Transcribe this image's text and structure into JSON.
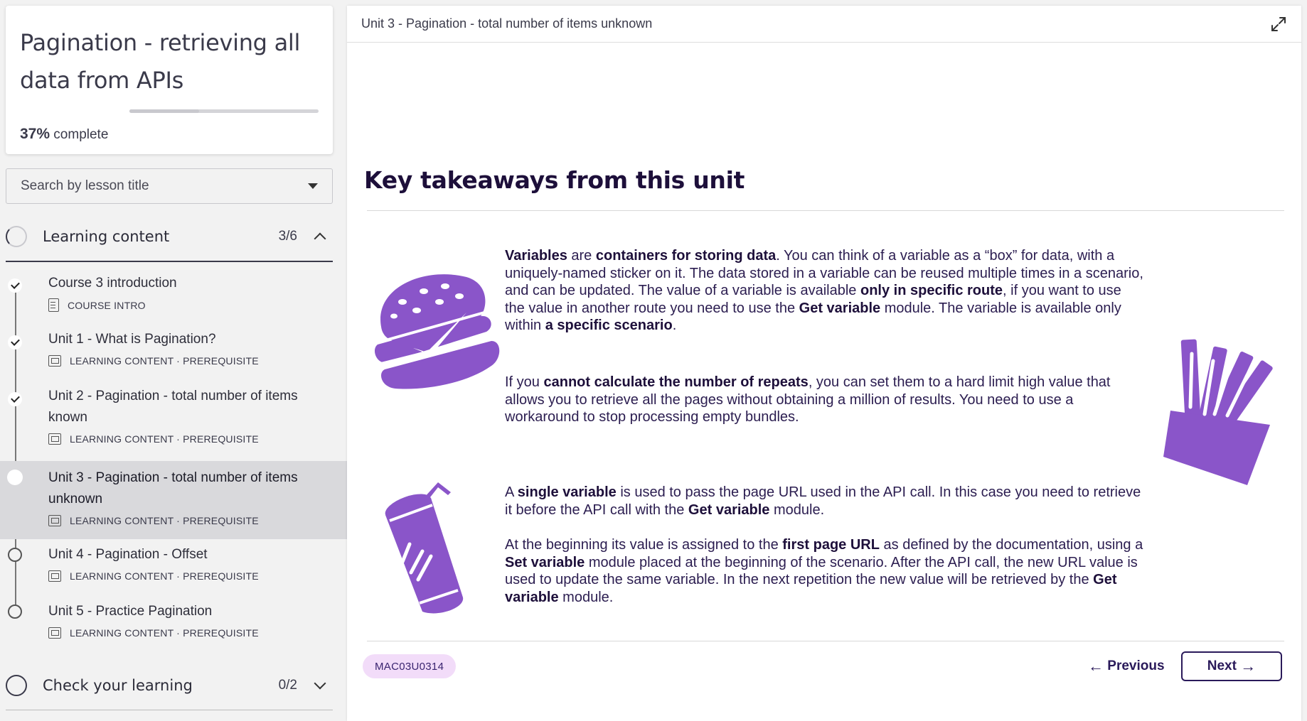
{
  "course": {
    "title": "Pagination - retrieving all data from APIs",
    "progress_percent": "37%",
    "progress_suffix": " complete",
    "progress_fraction": 0.37
  },
  "search": {
    "placeholder": "Search by lesson title"
  },
  "sections": [
    {
      "title": "Learning content",
      "count": "3/6",
      "expanded": true,
      "lessons": [
        {
          "title": "Course 3 introduction",
          "meta": "COURSE INTRO",
          "status": "done",
          "icon": "document-icon"
        },
        {
          "title": "Unit 1 - What is Pagination?",
          "meta": "LEARNING CONTENT · PREREQUISITE",
          "status": "done",
          "icon": "slides-icon"
        },
        {
          "title": "Unit 2 - Pagination - total number of items known",
          "meta": "LEARNING CONTENT · PREREQUISITE",
          "status": "done",
          "icon": "slides-icon"
        },
        {
          "title": "Unit 3 - Pagination - total number of items unknown",
          "meta": "LEARNING CONTENT · PREREQUISITE",
          "status": "current",
          "icon": "slides-icon"
        },
        {
          "title": "Unit 4 - Pagination - Offset",
          "meta": "LEARNING CONTENT · PREREQUISITE",
          "status": "open",
          "icon": "slides-icon"
        },
        {
          "title": "Unit 5 - Practice Pagination",
          "meta": "LEARNING CONTENT · PREREQUISITE",
          "status": "open",
          "icon": "slides-icon"
        }
      ]
    },
    {
      "title": "Check your learning",
      "count": "0/2",
      "expanded": false
    }
  ],
  "main": {
    "header_title": "Unit 3 - Pagination - total number of items unknown",
    "heading": "Key takeaways from this unit",
    "accent_color": "#8a55c9",
    "paragraphs": [
      [
        {
          "b": true,
          "t": "Variables"
        },
        {
          "t": " are "
        },
        {
          "b": true,
          "t": "containers for storing data"
        },
        {
          "t": ". You can think of a variable as a “box” for data, with a uniquely-named sticker on it. The data stored in a variable can be reused multiple times in a scenario, and can be updated. The value of a variable is available "
        },
        {
          "b": true,
          "t": "only in specific route"
        },
        {
          "t": ", if you want to use the value in another route you need to use the "
        },
        {
          "b": true,
          "t": "Get variable"
        },
        {
          "t": " module. The variable is available only within "
        },
        {
          "b": true,
          "t": "a specific scenario"
        },
        {
          "t": "."
        }
      ],
      [
        {
          "t": "If you "
        },
        {
          "b": true,
          "t": "cannot calculate the number of repeats"
        },
        {
          "t": ", you can set them to a hard limit high value that allows you to retrieve all the pages without obtaining a million of results. You need to use a workaround to stop processing empty bundles."
        }
      ],
      [
        {
          "t": "A "
        },
        {
          "b": true,
          "t": "single variable"
        },
        {
          "t": " is used to pass the page URL used in the API call. In this case you need to retrieve it before the API call with the "
        },
        {
          "b": true,
          "t": "Get variable"
        },
        {
          "t": " module."
        }
      ],
      [
        {
          "t": "At the beginning its value is assigned to the "
        },
        {
          "b": true,
          "t": "first page URL"
        },
        {
          "t": " as defined by the documentation, using a "
        },
        {
          "b": true,
          "t": "Set variable"
        },
        {
          "t": " module placed at the beginning of the scenario. After the API call, the new URL value is used to update the same variable. In the next repetition the new value will be retrieved by the "
        },
        {
          "b": true,
          "t": "Get variable"
        },
        {
          "t": " module."
        }
      ]
    ],
    "illustrations": [
      "burger-illustration",
      "fries-illustration",
      "soda-cup-illustration"
    ],
    "lesson_code": "MAC03U0314",
    "previous_label": "Previous",
    "next_label": "Next"
  }
}
